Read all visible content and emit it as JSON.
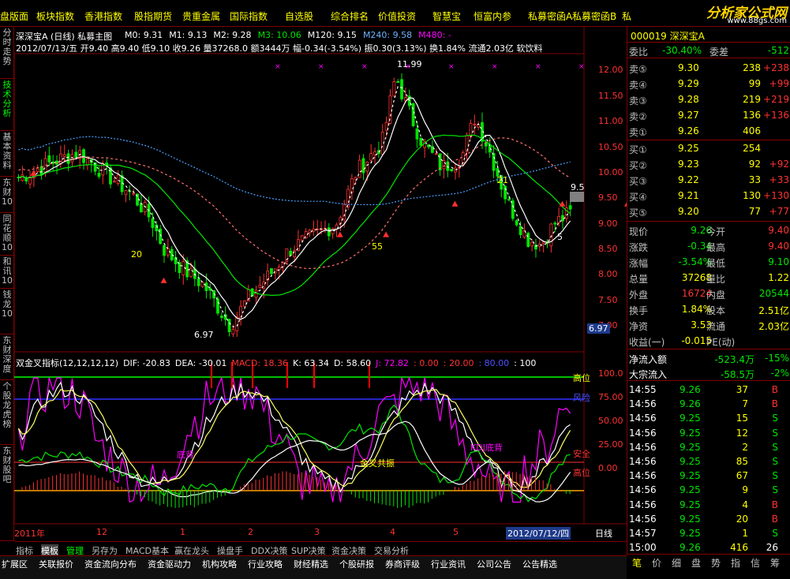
{
  "top_menu": [
    "盘版面",
    "板块指数",
    "香港指数",
    "股指期货",
    "贵重金属",
    "国际指数",
    "自选股",
    "综合排名",
    "价值投资",
    "智慧宝",
    "恒富内参",
    "私募密函A",
    "私募密函B",
    "私"
  ],
  "logo": {
    "title": "分析家公式网",
    "url": "www.88gs.com"
  },
  "left_tabs": [
    "分时走势",
    "技术分析",
    "基本资料",
    "东财10",
    "同花顺10",
    "和讯10",
    "钱龙10",
    "东财深度",
    "个股龙虎榜",
    "东财股吧"
  ],
  "main_header": {
    "line1": "深深宝A (日线) 私募主图",
    "ma": [
      "M0: 9.31",
      "M1: 9.13",
      "M2: 9.28",
      "M3: 10.06",
      "M120: 9.15",
      "M240: 9.58",
      "M480: -"
    ],
    "line2": "2012/07/13/五 开9.40 高9.40 低9.10 收9.26 量37268.0 额3444万 幅-0.34(-3.54%) 振0.30(3.13%) 换1.84% 流通2.03亿 软饮料"
  },
  "main_labels": {
    "high": "11.99",
    "low": "6.97",
    "l20": "20",
    "l55": "55",
    "l21": "21",
    "l5": "5",
    "price_tag": "9.5",
    "low_tag": "6.97"
  },
  "price_axis": [
    "12.00",
    "11.50",
    "11.00",
    "10.50",
    "10.00",
    "9.50",
    "9.00",
    "8.50",
    "8.00",
    "7.50",
    "7.00"
  ],
  "sub_header": {
    "name": "双金叉指标(12,12,12,12)",
    "dif": "DIF: -20.83",
    "dea": "DEA: -30.01",
    "macd": "MACD: 18.36",
    "k": "K: 63.34",
    "d": "D: 58.60",
    "j": "J: 72.82",
    "v1": ": 0.00",
    "v2": ": 20.00",
    "v3": ": 80.00",
    "v4": ": 100"
  },
  "sub_labels": {
    "gao": "高位",
    "di": "底背",
    "jin": "金叉共振",
    "kdj": "KDJ底背",
    "an": "安全",
    "wei": "风险",
    "gao2": "高位"
  },
  "sub_axis": [
    "100.0",
    "75.00",
    "50.00",
    "25.00",
    "0.00"
  ],
  "x_axis": {
    "labels": [
      "2011年",
      "12",
      "1",
      "2",
      "3",
      "4",
      "5"
    ],
    "date": "2012/07/12/四",
    "period": "日线"
  },
  "bottom_tabs": [
    "指标",
    "模板",
    "管理",
    "另存为",
    "MACD基本",
    "赢在龙头",
    "操盘手",
    "DDX决策",
    "SUP决策",
    "资金决策",
    "交易分析"
  ],
  "bottom_bar": [
    "扩展区",
    "关联报价",
    "资金流向分布",
    "资金驱动力",
    "机构攻略",
    "行业攻略",
    "财经精选",
    "个股研报",
    "券商评级",
    "行业资讯",
    "公司公告",
    "公告精选"
  ],
  "quote": {
    "code": "000019 深深宝A",
    "weibi": {
      "label": "委比",
      "value": "-30.40%",
      "label2": "委差",
      "value2": "-512"
    },
    "asks": [
      {
        "label": "卖⑤",
        "price": "9.30",
        "vol": "238",
        "chg": "+238"
      },
      {
        "label": "卖④",
        "price": "9.29",
        "vol": "99",
        "chg": "+99"
      },
      {
        "label": "卖③",
        "price": "9.28",
        "vol": "219",
        "chg": "+219"
      },
      {
        "label": "卖②",
        "price": "9.27",
        "vol": "136",
        "chg": "+136"
      },
      {
        "label": "卖①",
        "price": "9.26",
        "vol": "406",
        "chg": ""
      }
    ],
    "bids": [
      {
        "label": "买①",
        "price": "9.25",
        "vol": "254",
        "chg": ""
      },
      {
        "label": "买②",
        "price": "9.23",
        "vol": "92",
        "chg": "+92"
      },
      {
        "label": "买③",
        "price": "9.22",
        "vol": "33",
        "chg": "+33"
      },
      {
        "label": "买④",
        "price": "9.21",
        "vol": "130",
        "chg": "+130"
      },
      {
        "label": "买⑤",
        "price": "9.20",
        "vol": "77",
        "chg": "+77"
      }
    ],
    "stats": [
      {
        "l1": "现价",
        "v1": "9.26",
        "l2": "今开",
        "v2": "9.40"
      },
      {
        "l1": "涨跌",
        "v1": "-0.34",
        "l2": "最高",
        "v2": "9.40"
      },
      {
        "l1": "涨幅",
        "v1": "-3.54%",
        "l2": "最低",
        "v2": "9.10"
      },
      {
        "l1": "总量",
        "v1": "37268",
        "l2": "量比",
        "v2": "1.22"
      },
      {
        "l1": "外盘",
        "v1": "16724",
        "l2": "内盘",
        "v2": "20544"
      },
      {
        "l1": "换手",
        "v1": "1.84%",
        "l2": "股本",
        "v2": "2.51亿"
      },
      {
        "l1": "净资",
        "v1": "3.53",
        "l2": "流通",
        "v2": "2.03亿"
      },
      {
        "l1": "收益(一)",
        "v1": "-0.015",
        "l2": "PE(动)",
        "v2": ""
      }
    ],
    "flow": [
      {
        "label": "净流入额",
        "value": "-523.4万",
        "pct": "-15%"
      },
      {
        "label": "大宗流入",
        "value": "-58.5万",
        "pct": "-2%"
      }
    ],
    "ticks": [
      {
        "t": "14:55",
        "p": "9.26",
        "v": "37",
        "s": "B"
      },
      {
        "t": "14:56",
        "p": "9.26",
        "v": "7",
        "s": "B"
      },
      {
        "t": "14:56",
        "p": "9.25",
        "v": "15",
        "s": "S"
      },
      {
        "t": "14:56",
        "p": "9.25",
        "v": "12",
        "s": "S"
      },
      {
        "t": "14:56",
        "p": "9.25",
        "v": "2",
        "s": "S"
      },
      {
        "t": "14:56",
        "p": "9.25",
        "v": "85",
        "s": "S"
      },
      {
        "t": "14:56",
        "p": "9.25",
        "v": "67",
        "s": "S"
      },
      {
        "t": "14:56",
        "p": "9.25",
        "v": "9",
        "s": "S"
      },
      {
        "t": "14:56",
        "p": "9.25",
        "v": "4",
        "s": "B"
      },
      {
        "t": "14:56",
        "p": "9.25",
        "v": "20",
        "s": "B"
      },
      {
        "t": "14:57",
        "p": "9.25",
        "v": "1",
        "s": "S"
      },
      {
        "t": "15:00",
        "p": "9.26",
        "v": "416",
        "s": "26"
      }
    ],
    "bottom_icons": [
      "笔",
      "价",
      "细",
      "盘",
      "势",
      "指",
      "信",
      "筹"
    ]
  },
  "colors": {
    "up": "#ff3232",
    "down": "#00e600",
    "bg": "#000000",
    "grid": "#800000"
  }
}
